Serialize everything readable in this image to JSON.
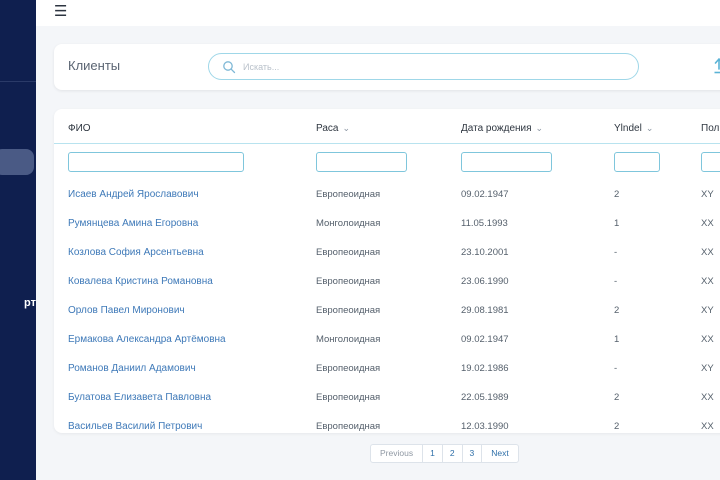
{
  "sidebar": {
    "cut_label": "рт"
  },
  "header": {
    "menu_icon": "hamburger-icon",
    "menu_glyph": "☰"
  },
  "page": {
    "title": "Клиенты",
    "search_placeholder": "Искать...",
    "upload_icon": "upload-icon"
  },
  "table": {
    "columns": [
      {
        "label": "ФИО",
        "sortable": false
      },
      {
        "label": "Раса",
        "sortable": true
      },
      {
        "label": "Дата рождения",
        "sortable": true
      },
      {
        "label": "Ylndel",
        "sortable": true
      },
      {
        "label": "Пол",
        "sortable": false
      }
    ],
    "rows": [
      {
        "name": "Исаев Андрей Ярославович",
        "race": "Европеоидная",
        "birth": "09.02.1947",
        "ylndel": "2",
        "sex": "XY"
      },
      {
        "name": "Румянцева Амина Егоровна",
        "race": "Монголоидная",
        "birth": "11.05.1993",
        "ylndel": "1",
        "sex": "XX"
      },
      {
        "name": "Козлова София Арсентьевна",
        "race": "Европеоидная",
        "birth": "23.10.2001",
        "ylndel": "-",
        "sex": "XX"
      },
      {
        "name": "Ковалева Кристина Романовна",
        "race": "Европеоидная",
        "birth": "23.06.1990",
        "ylndel": "-",
        "sex": "XX"
      },
      {
        "name": "Орлов Павел Миронович",
        "race": "Европеоидная",
        "birth": "29.08.1981",
        "ylndel": "2",
        "sex": "XY"
      },
      {
        "name": "Ермакова Александра Артёмовна",
        "race": "Монголоидная",
        "birth": "09.02.1947",
        "ylndel": "1",
        "sex": "XX"
      },
      {
        "name": "Романов Даниил Адамович",
        "race": "Европеоидная",
        "birth": "19.02.1986",
        "ylndel": "-",
        "sex": "XY"
      },
      {
        "name": "Булатова Елизавета Павловна",
        "race": "Европеоидная",
        "birth": "22.05.1989",
        "ylndel": "2",
        "sex": "XX"
      },
      {
        "name": "Васильев Василий Петрович",
        "race": "Европеоидная",
        "birth": "12.03.1990",
        "ylndel": "2",
        "sex": "XX"
      }
    ]
  },
  "pagination": {
    "previous": "Previous",
    "pages": [
      "1",
      "2",
      "3"
    ],
    "next": "Next"
  },
  "colors": {
    "sidebar_bg": "#0f1f4f",
    "accent": "#7fc6dc",
    "link": "#3e79b8"
  }
}
